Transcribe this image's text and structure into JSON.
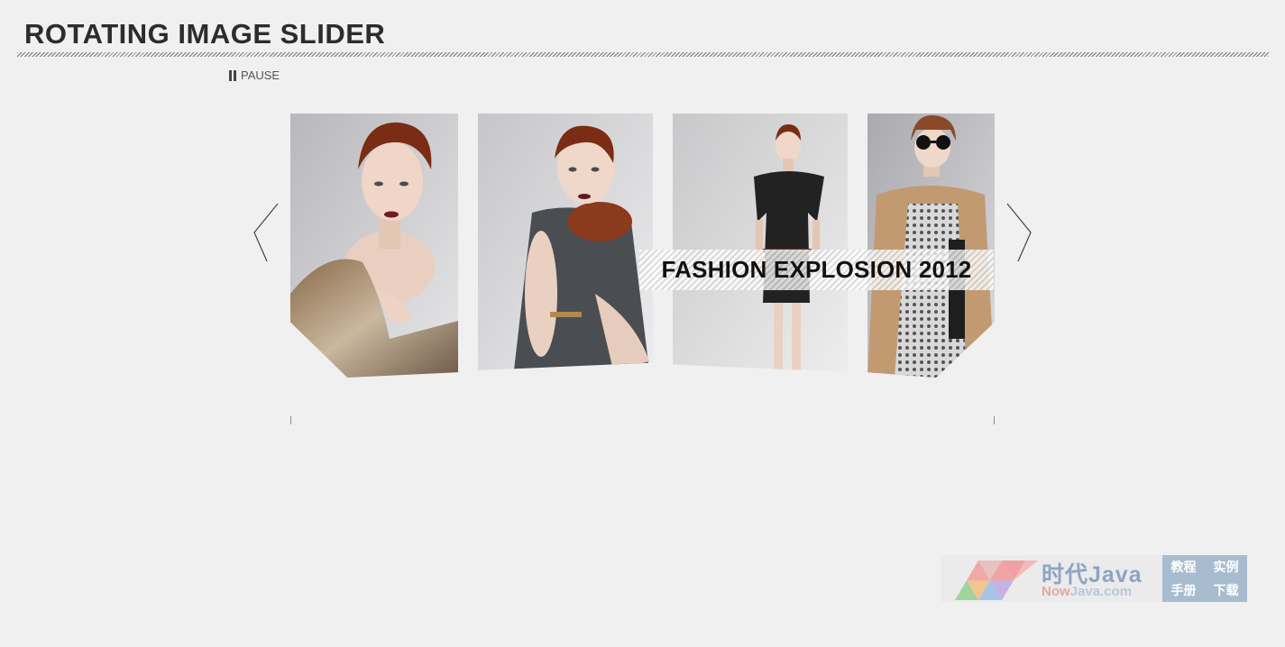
{
  "page": {
    "title": "ROTATING IMAGE SLIDER"
  },
  "controls": {
    "pause_label": "PAUSE"
  },
  "slider": {
    "caption": "FASHION EXPLOSION 2012",
    "slides": [
      {
        "description": "fashion-model-fur-stole"
      },
      {
        "description": "fashion-model-braided-scarf"
      },
      {
        "description": "fashion-model-black-dress"
      },
      {
        "description": "fashion-model-sunglasses-jacket"
      }
    ]
  },
  "watermark": {
    "brand": "时代Java",
    "domain_prefix": "Now",
    "domain_suffix": "Java.com",
    "links": [
      "教程",
      "实例",
      "手册",
      "下载"
    ]
  },
  "colors": {
    "background": "#f0f0f0",
    "title": "#2c2c2c",
    "watermark_accent": "#8da4c4"
  }
}
